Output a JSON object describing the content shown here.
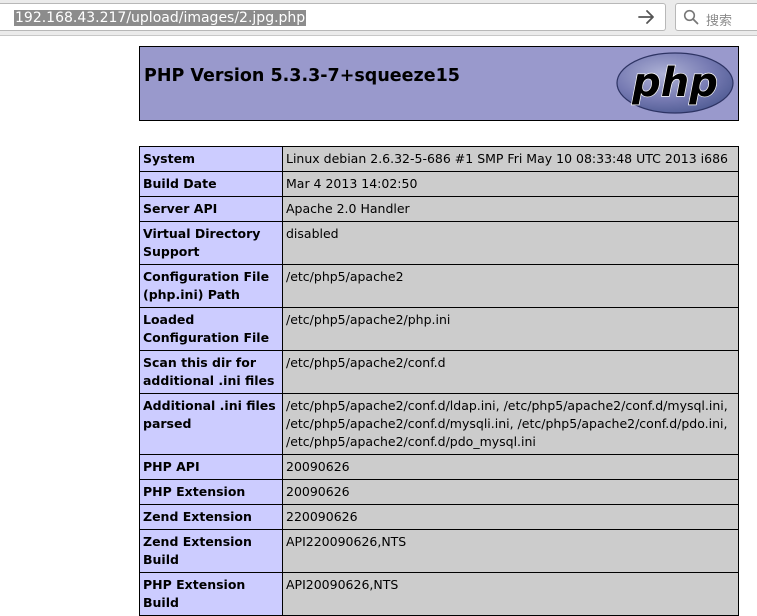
{
  "browser": {
    "url": "192.168.43.217/upload/images/2.jpg.php",
    "search_placeholder": "搜索"
  },
  "header": {
    "title": "PHP Version 5.3.3-7+squeeze15",
    "logo_text": "php"
  },
  "rows": [
    {
      "label": "System",
      "value": "Linux debian 2.6.32-5-686 #1 SMP Fri May 10 08:33:48 UTC 2013 i686"
    },
    {
      "label": "Build Date",
      "value": "Mar 4 2013 14:02:50"
    },
    {
      "label": "Server API",
      "value": "Apache 2.0 Handler"
    },
    {
      "label": "Virtual Directory Support",
      "value": "disabled"
    },
    {
      "label": "Configuration File (php.ini) Path",
      "value": "/etc/php5/apache2"
    },
    {
      "label": "Loaded Configuration File",
      "value": "/etc/php5/apache2/php.ini"
    },
    {
      "label": "Scan this dir for additional .ini files",
      "value": "/etc/php5/apache2/conf.d"
    },
    {
      "label": "Additional .ini files parsed",
      "value": "/etc/php5/apache2/conf.d/ldap.ini, /etc/php5/apache2/conf.d/mysql.ini, /etc/php5/apache2/conf.d/mysqli.ini, /etc/php5/apache2/conf.d/pdo.ini, /etc/php5/apache2/conf.d/pdo_mysql.ini"
    },
    {
      "label": "PHP API",
      "value": "20090626"
    },
    {
      "label": "PHP Extension",
      "value": "20090626"
    },
    {
      "label": "Zend Extension",
      "value": "220090626"
    },
    {
      "label": "Zend Extension Build",
      "value": "API220090626,NTS"
    },
    {
      "label": "PHP Extension Build",
      "value": "API20090626,NTS"
    }
  ],
  "colors": {
    "header_bg": "#9999cc",
    "label_bg": "#ccccff",
    "value_bg": "#cccccc"
  }
}
